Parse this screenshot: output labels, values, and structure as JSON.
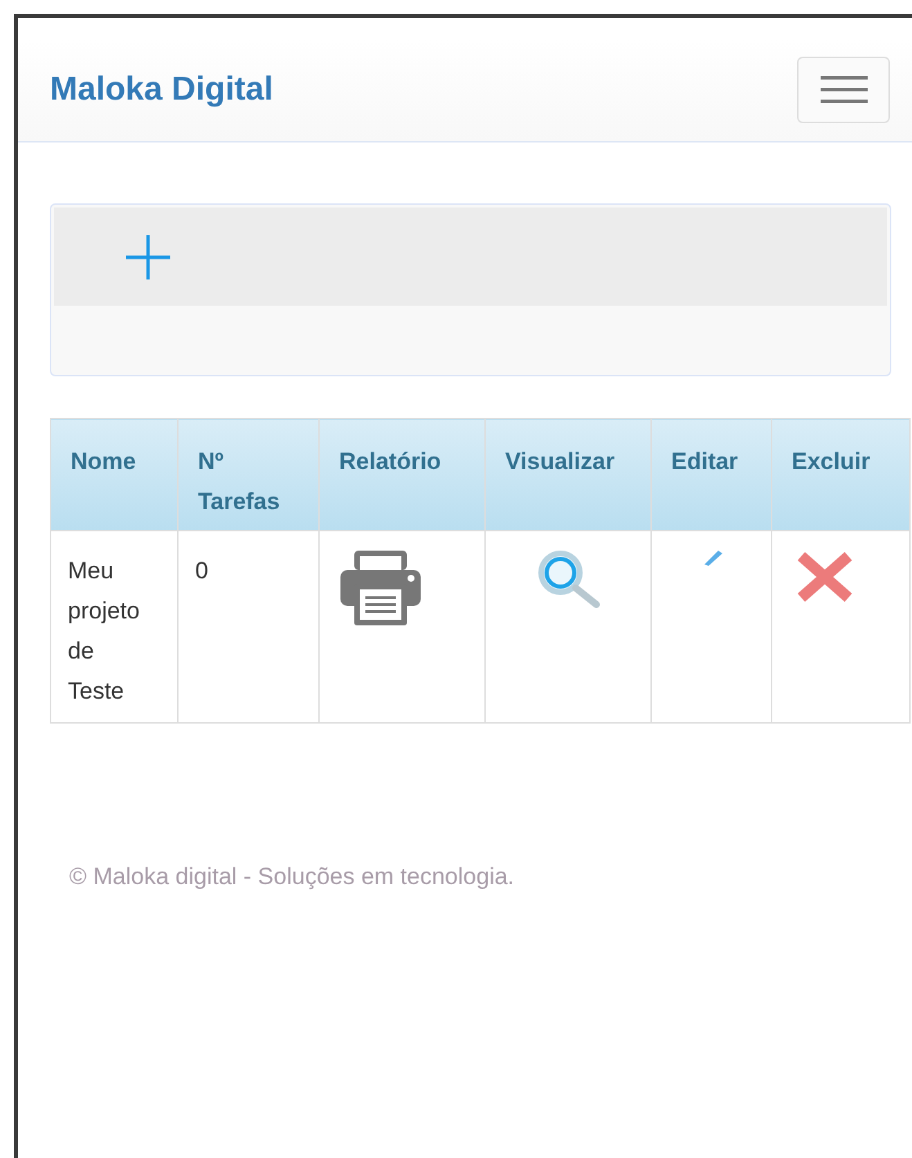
{
  "navbar": {
    "brand": "Maloka Digital"
  },
  "table": {
    "columns": [
      "Nome",
      "Nº Tarefas",
      "Relatório",
      "Visualizar",
      "Editar",
      "Excluir"
    ],
    "rows": [
      {
        "nome": "Meu projeto de Teste",
        "tarefas": "0"
      }
    ]
  },
  "footer": "© Maloka digital - Soluções em tecnologia."
}
